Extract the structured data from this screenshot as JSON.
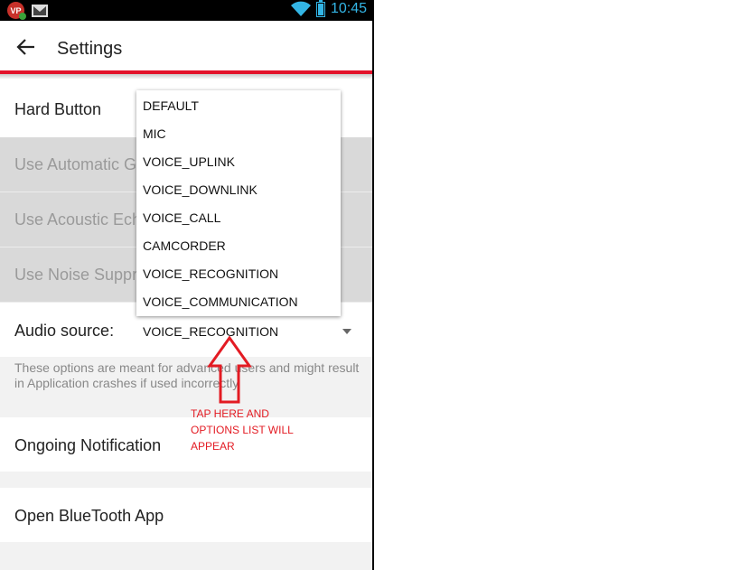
{
  "status_bar": {
    "app_badge": "VP",
    "time": "10:45"
  },
  "toolbar": {
    "title": "Settings"
  },
  "settings": {
    "hard_button": "Hard Button",
    "automatic_gain": "Use Automatic Gain Control",
    "acoustic_echo": "Use Acoustic Echo Canceler",
    "noise_suppressor": "Use Noise Suppressor",
    "audio_source_label": "Audio source:",
    "audio_source_value": "VOICE_RECOGNITION",
    "note": "These options are meant for advanced users and might result in Application crashes if used incorrectly",
    "ongoing_notification": "Ongoing Notification",
    "open_bluetooth": "Open BlueTooth App"
  },
  "dropdown": {
    "options": [
      "DEFAULT",
      "MIC",
      "VOICE_UPLINK",
      "VOICE_DOWNLINK",
      "VOICE_CALL",
      "CAMCORDER",
      "VOICE_RECOGNITION",
      "VOICE_COMMUNICATION"
    ]
  },
  "annotation": {
    "line1": "TAP HERE AND",
    "line2": "OPTIONS LIST WILL",
    "line3": "APPEAR"
  },
  "colors": {
    "accent_red": "#e3122a",
    "clock_blue": "#33b5e5",
    "disabled_bg": "#d9d9d9",
    "annotation_red": "#e31b23"
  },
  "icons": [
    "vp-app-icon",
    "mail-icon",
    "wifi-icon",
    "battery-icon",
    "back-arrow-icon",
    "dropdown-caret-icon",
    "up-arrow-annotation-icon"
  ]
}
